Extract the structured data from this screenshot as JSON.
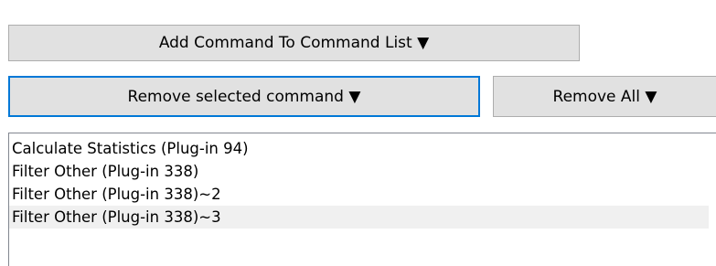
{
  "buttons": {
    "add_command": "Add Command To Command List ▼",
    "remove_selected": "Remove selected command ▼",
    "remove_all": "Remove All ▼"
  },
  "command_list": {
    "items": [
      "Calculate Statistics (Plug-in 94)",
      "Filter Other (Plug-in 338)",
      "Filter Other (Plug-in 338)~2",
      "Filter Other (Plug-in 338)~3"
    ],
    "selected_index": 3
  },
  "colors": {
    "button_face": "#e1e1e1",
    "button_border": "#adadad",
    "focus_border": "#0078d7",
    "list_border": "#828790",
    "selected_row": "#f0f0f0"
  }
}
